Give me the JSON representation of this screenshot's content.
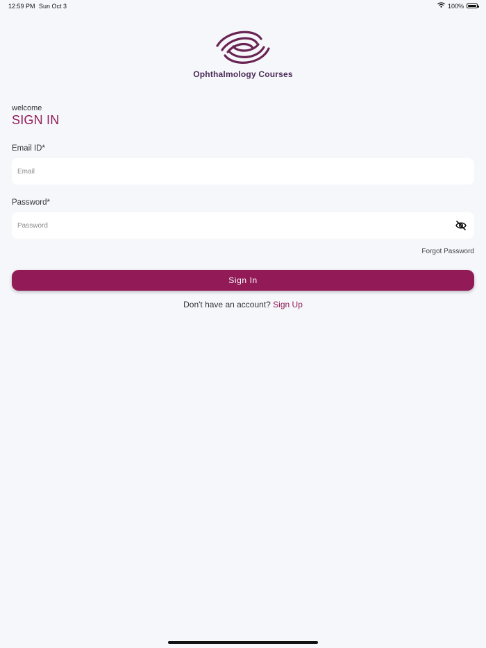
{
  "status_bar": {
    "time": "12:59 PM",
    "date": "Sun Oct 3",
    "battery_percent": "100%",
    "battery_level": 1.0,
    "icons": [
      "wifi-icon",
      "battery-icon"
    ]
  },
  "brand": {
    "name": "Ophthalmology Courses",
    "logo_icon": "eye-logo-icon",
    "logo_color": "#6a2453"
  },
  "form": {
    "greeting": "welcome",
    "title": "SIGN IN",
    "email": {
      "label": "Email ID*",
      "placeholder": "Email",
      "value": ""
    },
    "password": {
      "label": "Password*",
      "placeholder": "Password",
      "value": "",
      "toggle_icon": "eye-off-icon"
    },
    "forgot_password": "Forgot Password",
    "submit_label": "Sign In",
    "signup_prompt": "Don't have an account?",
    "signup_link": "Sign Up"
  },
  "colors": {
    "accent": "#911a57",
    "background": "#f6f7fb",
    "input_background": "#ffffff"
  }
}
